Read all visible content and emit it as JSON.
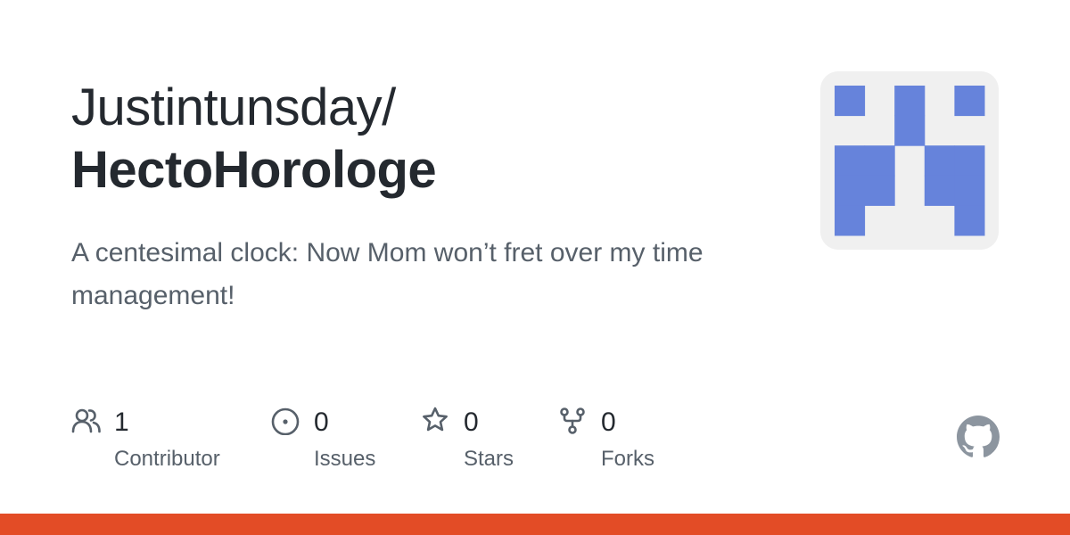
{
  "header": {
    "owner": "Justintunsday/",
    "repo": "HectoHorologe"
  },
  "description": "A centesimal clock: Now Mom won’t fret over my time management!",
  "stats": [
    {
      "icon": "people-icon",
      "value": "1",
      "label": "Contributor"
    },
    {
      "icon": "issue-icon",
      "value": "0",
      "label": "Issues"
    },
    {
      "icon": "star-icon",
      "value": "0",
      "label": "Stars"
    },
    {
      "icon": "fork-icon",
      "value": "0",
      "label": "Forks"
    }
  ],
  "colors": {
    "identicon_fill": "#6683db",
    "identicon_bg": "#f0f0f0",
    "icon_stroke": "#57606a",
    "github_logo": "#8c959f",
    "language_bar": "#e34c26"
  }
}
